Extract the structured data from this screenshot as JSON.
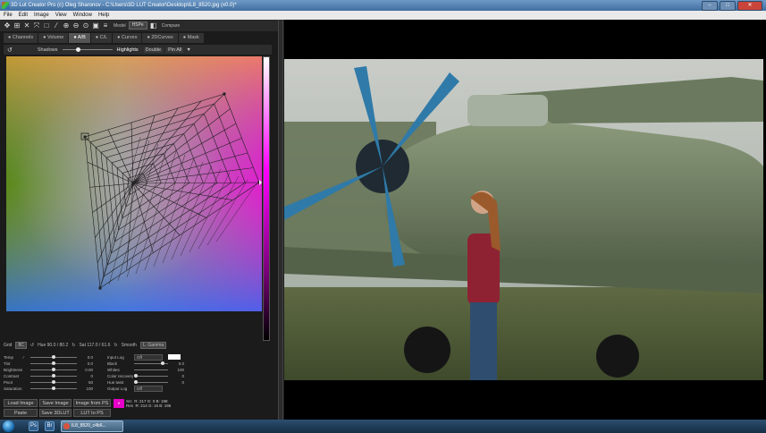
{
  "window": {
    "title": "3D Lut Creator Pro (c) Oleg Sharonov - C:\\Users\\3D LUT Creator\\Desktop\\IL8_8520.jpg (x0.0)*",
    "minimize": "–",
    "maximize": "□",
    "close": "✕"
  },
  "menu": [
    "File",
    "Edit",
    "Image",
    "View",
    "Window",
    "Help"
  ],
  "toolbar": {
    "model_label": "Model",
    "model_value": "HSPe",
    "compare_label": "Compare"
  },
  "tabs": [
    {
      "label": "Channels",
      "active": false
    },
    {
      "label": "Volume",
      "active": false
    },
    {
      "label": "A/B",
      "active": true
    },
    {
      "label": "C/L",
      "active": false
    },
    {
      "label": "Curves",
      "active": false
    },
    {
      "label": "2DCurves",
      "active": false
    },
    {
      "label": "Mask",
      "active": false
    }
  ],
  "shadows_bar": {
    "shadows": "Shadows",
    "highlights": "Highlights",
    "double": "Double",
    "pin_all": "Pin All",
    "level": 0.3
  },
  "grid_bar": {
    "grid_label": "Grid",
    "grid_value": "8C",
    "hue_label": "Hue 90.0 / 80.2",
    "sat_label": "Sat 117.0 / 61.6",
    "smooth": "Smooth",
    "gamma": "L. Gamma"
  },
  "params_left": [
    {
      "label": "Temp",
      "value": "0.0",
      "level": 0.5
    },
    {
      "label": "Tint",
      "value": "0.0",
      "level": 0.5
    },
    {
      "label": "Brightness",
      "value": "0.00",
      "level": 0.5
    },
    {
      "label": "Contrast",
      "value": "0",
      "level": 0.5
    },
    {
      "label": "Pivot",
      "value": "50",
      "level": 0.5
    },
    {
      "label": "Saturation",
      "value": "100",
      "level": 0.5
    }
  ],
  "params_right": [
    {
      "label": "Input Log",
      "value": "Off"
    },
    {
      "label": "Black",
      "value": "0.0"
    },
    {
      "label": "Whites",
      "value": "100"
    },
    {
      "label": "Color recovery",
      "value": "0"
    },
    {
      "label": "Hue twist",
      "value": "0"
    },
    {
      "label": "Output Log",
      "value": "Off"
    }
  ],
  "buttons": {
    "load_image": "Load Image",
    "save_image": "Save Image",
    "image_from_ps": "Image from PS",
    "paste": "Paste",
    "save_3dlut": "Save 3DLUT",
    "lut_to_ps": "LUT to PS"
  },
  "swatch": {
    "src": "Src",
    "res": "Res",
    "color": "#e800c8"
  },
  "readout": {
    "line1": "R: 217  G: 0  B: 198",
    "line2": "R: 214  G: 16  B: 195"
  },
  "taskbar": {
    "task_label": "IL8_8520_c4b6...",
    "icon_ps": "Ps",
    "icon_br": "Br"
  },
  "colors": {
    "accent": "#3f6e9e",
    "panel": "#1b1b1b",
    "magenta": "#e800c8"
  }
}
